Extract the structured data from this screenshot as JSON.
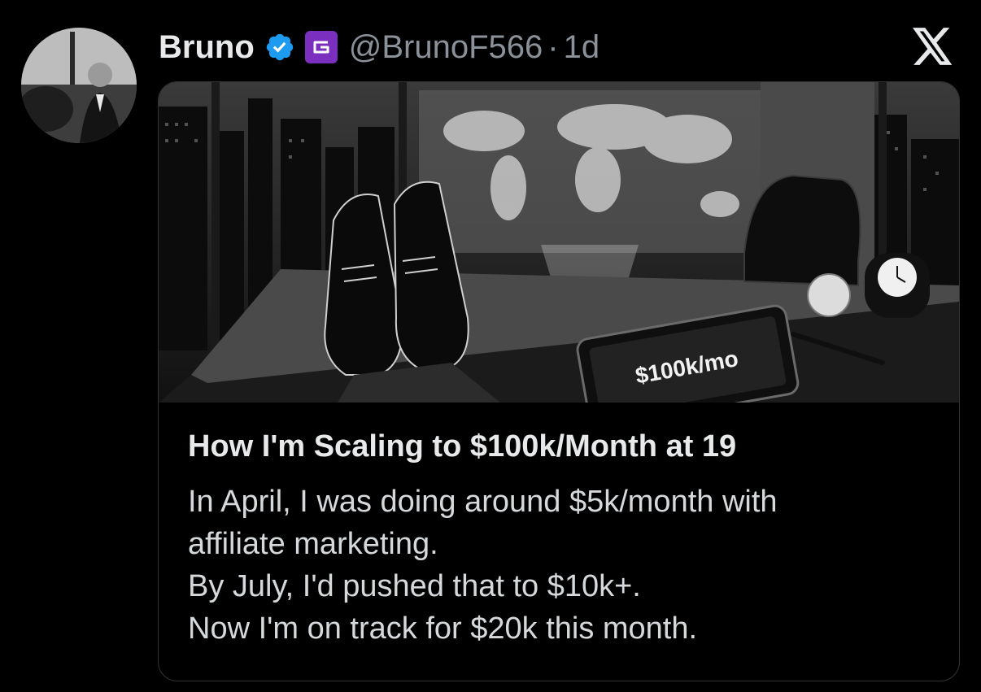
{
  "author": {
    "name": "Bruno",
    "handle": "@BrunoF566",
    "separator": "·",
    "time": "1d",
    "verified_icon": "verified-badge-icon",
    "affiliate_badge_icon": "affiliate-logo-icon",
    "affiliate_color": "#7b2fbe"
  },
  "brand": {
    "logo_icon": "x-logo-icon"
  },
  "card": {
    "image_caption": "$100k/mo",
    "title": "How I'm Scaling to $100k/Month at 19",
    "body_lines": [
      "In April, I was doing around $5k/month with",
      "affiliate marketing.",
      "By July, I'd pushed that to $10k+.",
      "Now I'm on track for $20k this month."
    ]
  },
  "colors": {
    "background": "#000000",
    "verified_blue": "#1d9bf0",
    "border": "#2f3336",
    "secondary_text": "#8b9198"
  }
}
